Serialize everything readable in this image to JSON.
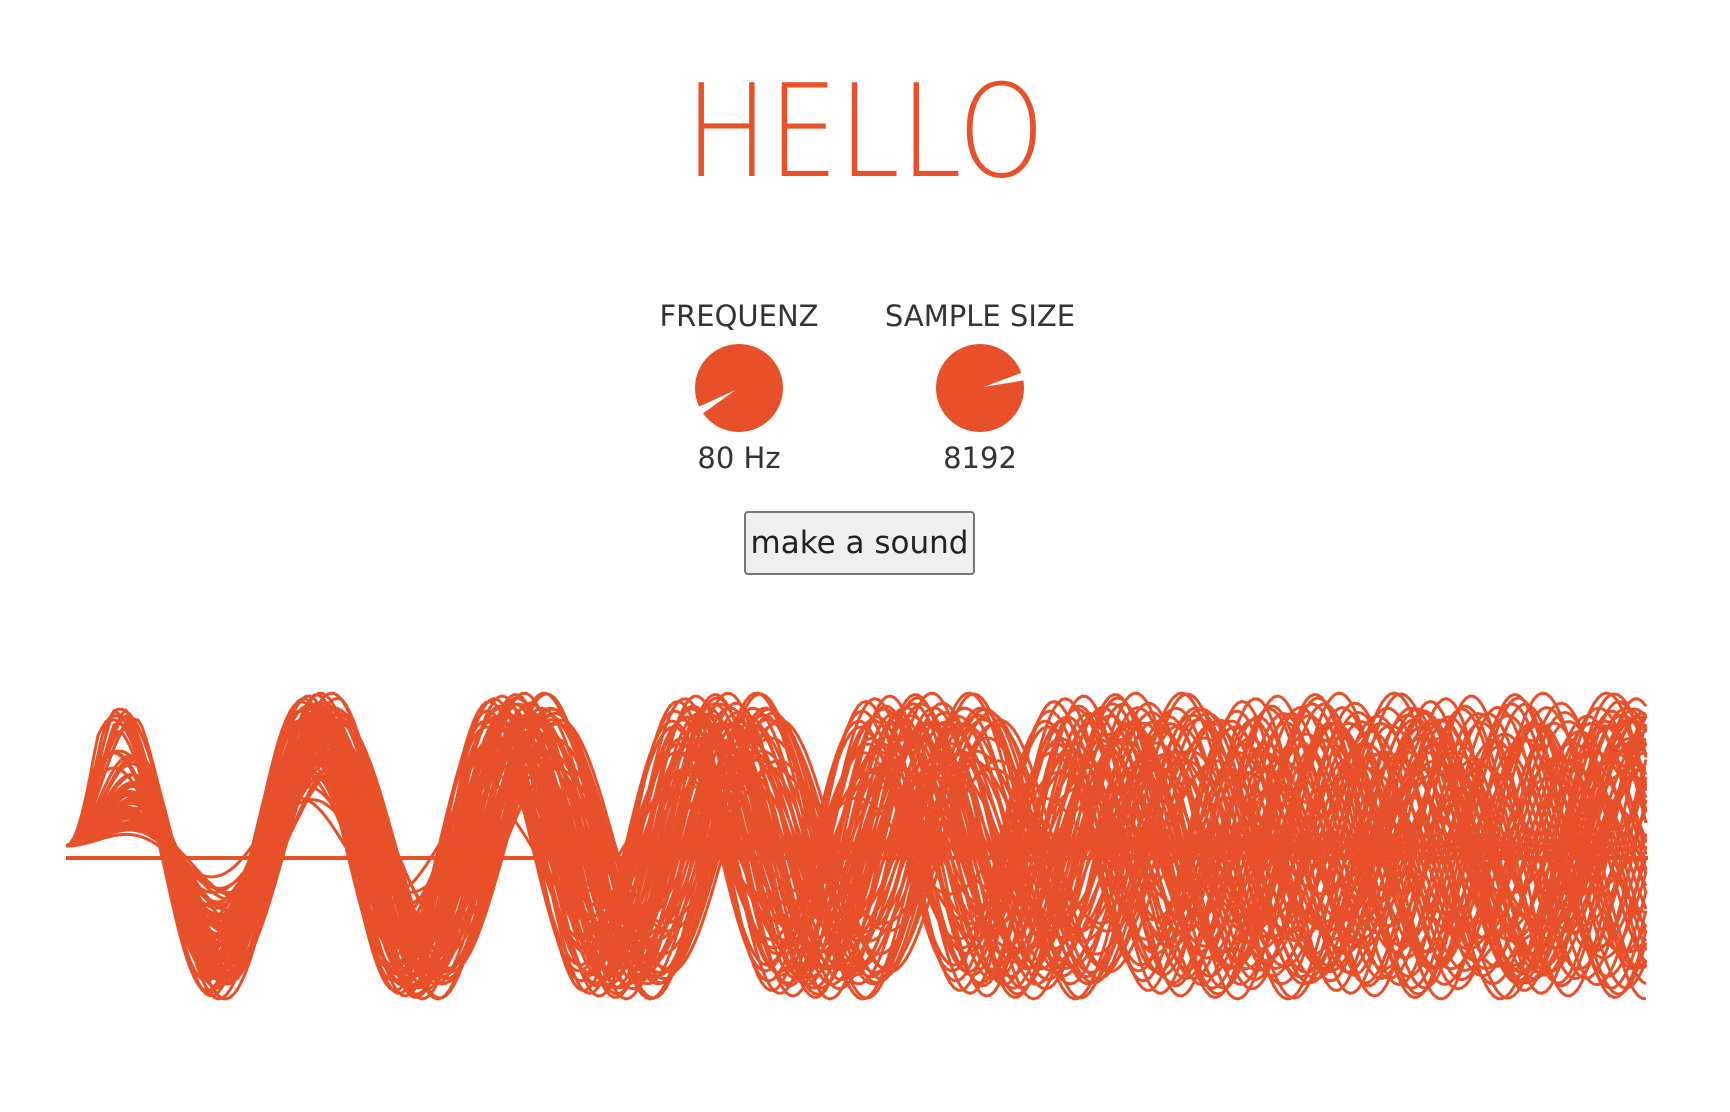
{
  "header": {
    "title": "HELLO",
    "title_color": "#e8502a"
  },
  "controls": {
    "frequency": {
      "label": "FREQUENZ",
      "value_text": "80 Hz",
      "level": 0.1
    },
    "sample_size": {
      "label": "SAMPLE SIZE",
      "value_text": "8192",
      "level": 0.75
    },
    "sound_button_label": "make a sound"
  },
  "waveform": {
    "color": "#e8502a"
  }
}
